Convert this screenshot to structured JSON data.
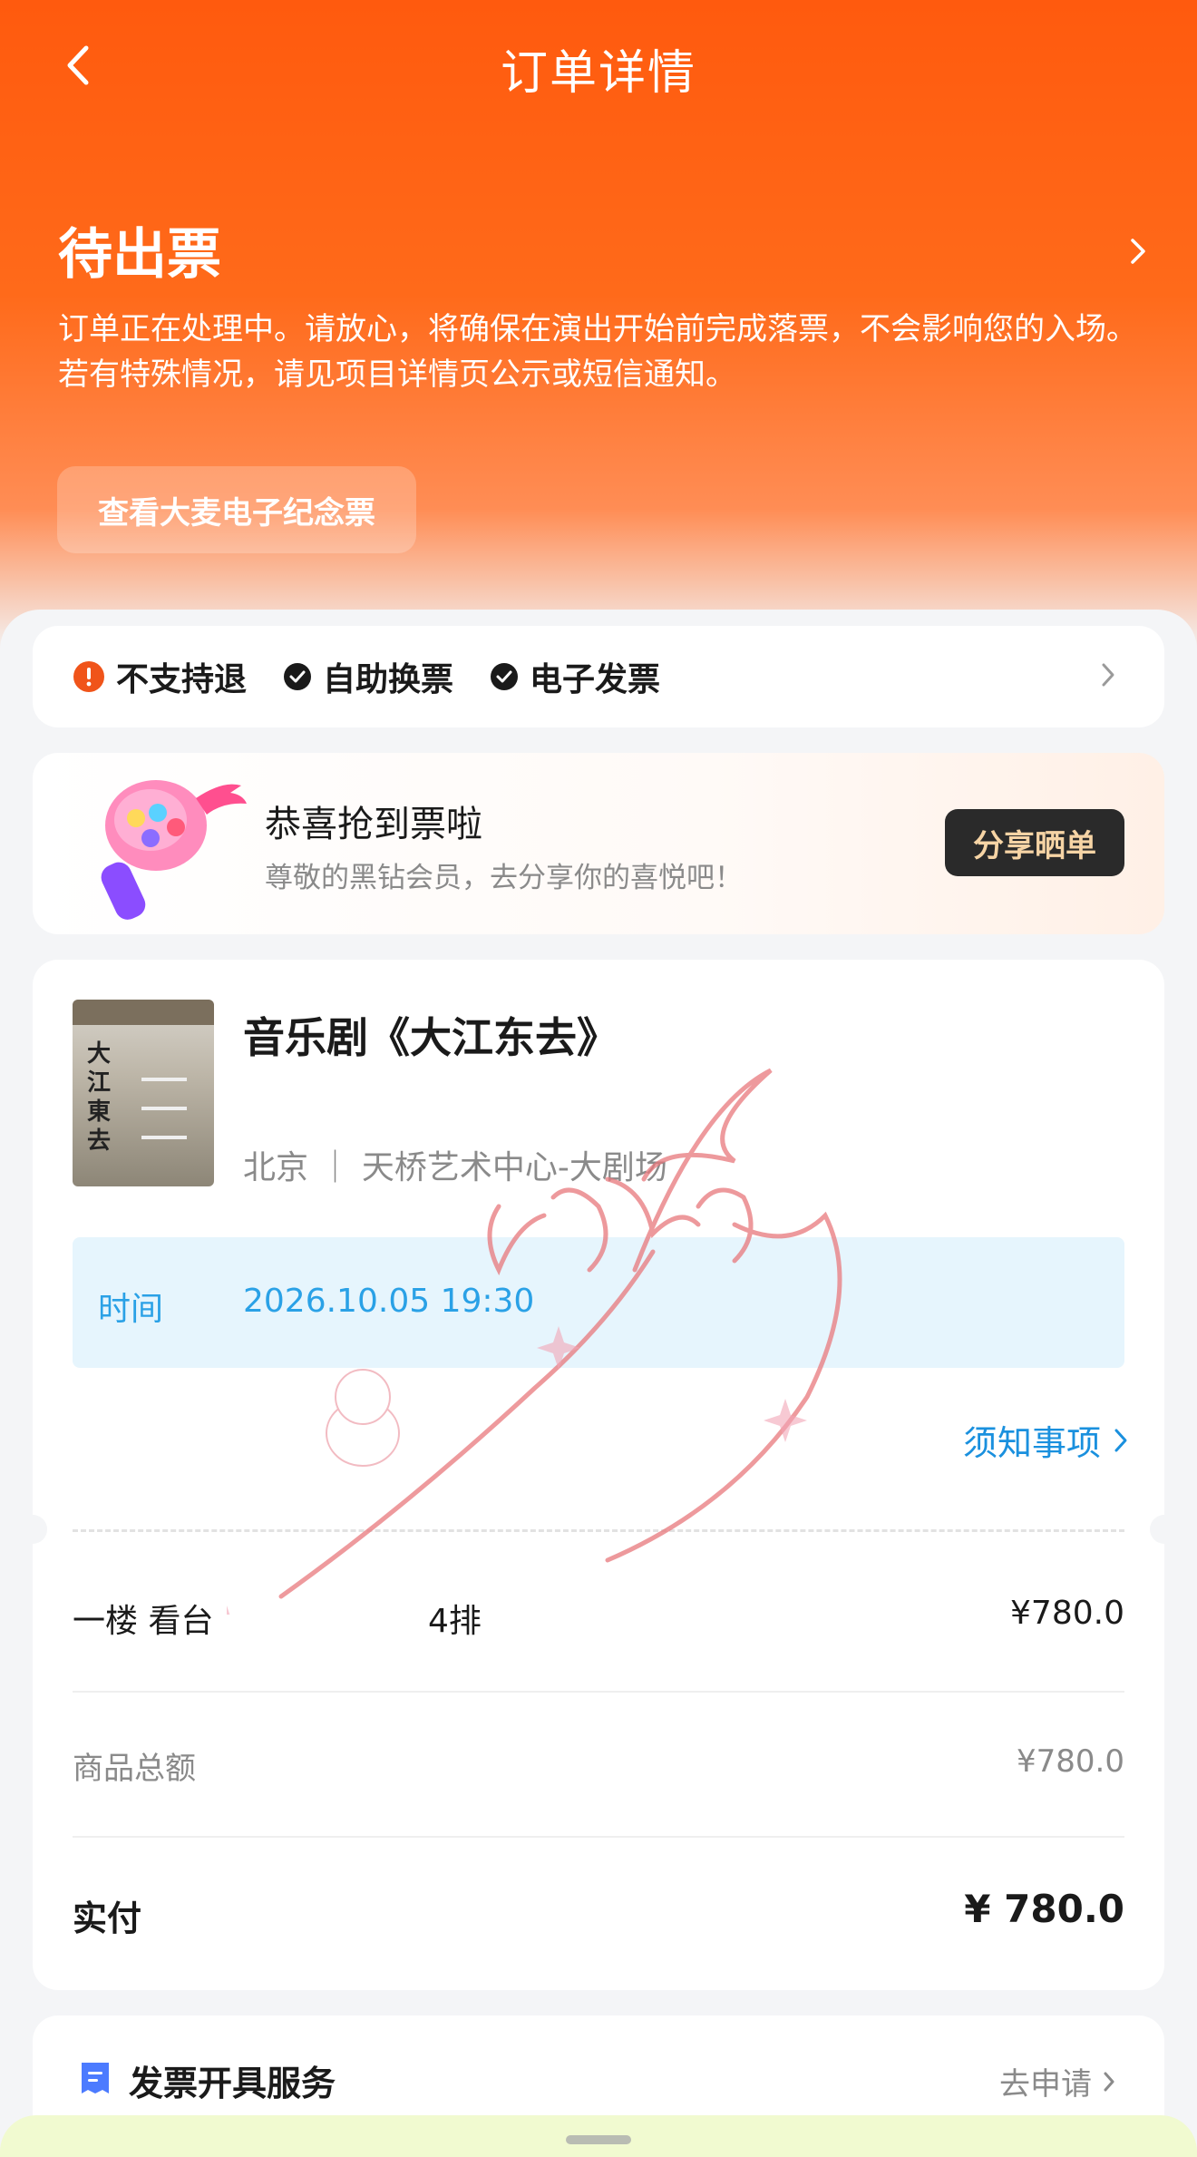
{
  "header": {
    "title": "订单详情",
    "back_icon": "back-arrow-icon"
  },
  "status": {
    "title": "待出票",
    "description": "订单正在处理中。请放心，将确保在演出开始前完成落票，不会影响您的入场。若有特殊情况，请见项目详情页公示或短信通知。",
    "souvenir_button": "查看大麦电子纪念票"
  },
  "policies": [
    {
      "label": "不支持退",
      "icon": "warning-icon",
      "color": "#f0541a"
    },
    {
      "label": "自助换票",
      "icon": "check-icon",
      "color": "#1a1a1a"
    },
    {
      "label": "电子发票",
      "icon": "check-icon",
      "color": "#1a1a1a"
    }
  ],
  "congrats": {
    "title": "恭喜抢到票啦",
    "subtitle": "尊敬的黑钻会员，去分享你的喜悦吧！",
    "share_button": "分享晒单"
  },
  "order": {
    "poster_text": "大江東去",
    "event_title": "音乐剧《大江东去》",
    "venue": "北京 ｜ 天桥艺术中心-大剧场",
    "time_label": "时间",
    "time_value": "2026.10.05 19:30",
    "notice_link": "须知事项",
    "seat_name": "一楼 看台",
    "seat_row": "4排",
    "seat_price": "¥780.0",
    "subtotal_label": "商品总额",
    "subtotal_value": "¥780.0",
    "paid_label": "实付",
    "paid_value": "¥ 780.0"
  },
  "invoice": {
    "title": "发票开具服务",
    "action": "去申请",
    "icon": "invoice-icon"
  },
  "colors": {
    "brand_orange": "#ff5a0e",
    "link_blue": "#1a90de",
    "time_bg": "#e6f5fd"
  }
}
